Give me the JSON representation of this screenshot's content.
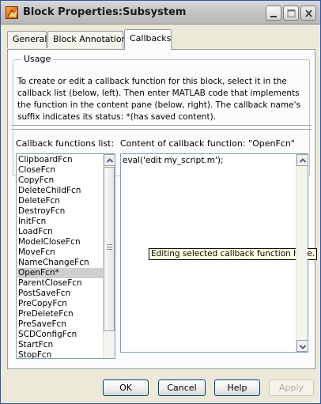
{
  "window": {
    "title": "Block Properties:Subsystem"
  },
  "tabs": [
    {
      "label": "General"
    },
    {
      "label": "Block Annotation"
    },
    {
      "label": "Callbacks"
    }
  ],
  "usage": {
    "legend": "Usage",
    "text": "To create or edit a callback function for this block, select it in the callback list (below, left). Then enter MATLAB code that implements the function in the content pane (below, right). The callback name's suffix indicates its status: *(has saved content)."
  },
  "callbacks": {
    "list_label": "Callback functions list:",
    "items": [
      "ClipboardFcn",
      "CloseFcn",
      "CopyFcn",
      "DeleteChildFcn",
      "DeleteFcn",
      "DestroyFcn",
      "InitFcn",
      "LoadFcn",
      "ModelCloseFcn",
      "MoveFcn",
      "NameChangeFcn",
      "OpenFcn*",
      "ParentCloseFcn",
      "PostSaveFcn",
      "PreCopyFcn",
      "PreDeleteFcn",
      "PreSaveFcn",
      "SCDConfigFcn",
      "StartFcn",
      "StopFcn"
    ],
    "selected": "OpenFcn*"
  },
  "content": {
    "label": "Content of callback function: \"OpenFcn\"",
    "code": "eval('edit my_script.m');",
    "tooltip": "Editing selected callback function here."
  },
  "buttons": {
    "ok": "OK",
    "cancel": "Cancel",
    "help": "Help",
    "apply": "Apply"
  },
  "icons": {
    "app": "matlab-logo-icon",
    "minimize": "minimize-icon",
    "maximize": "maximize-icon",
    "close": "close-icon"
  }
}
